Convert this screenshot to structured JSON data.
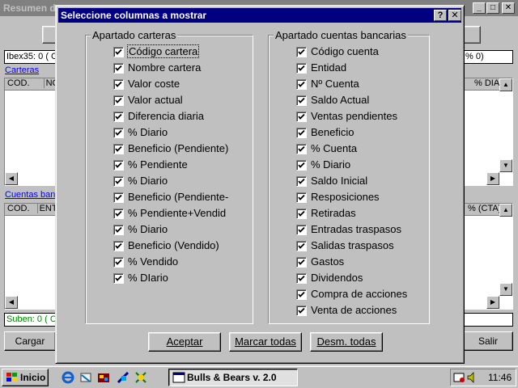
{
  "main_window": {
    "title": "Resumen d",
    "ibex_text": "Ibex35: 0  ( C",
    "ibex_right_text": "%  0)",
    "carteras_link": "Carteras",
    "grid1_headers": [
      "COD.",
      "NO"
    ],
    "grid1_right_header": "% DIA",
    "cuentas_link": "Cuentas banc",
    "grid2_headers": [
      "COD.",
      "ENT"
    ],
    "grid2_right_header": "% (CTA)",
    "suben_text": "Suben: 0  ( C",
    "cargar_label": "Cargar",
    "salir_label": "Salir"
  },
  "dialog": {
    "title": "Seleccione columnas a mostrar",
    "help_button": "?",
    "close_button": "✕",
    "group_carteras": {
      "legend": "Apartado carteras",
      "options": [
        {
          "label": "Código cartera",
          "checked": true
        },
        {
          "label": "Nombre cartera",
          "checked": true
        },
        {
          "label": "Valor coste",
          "checked": true
        },
        {
          "label": "Valor actual",
          "checked": true
        },
        {
          "label": "Diferencia diaria",
          "checked": true
        },
        {
          "label": "% Diario",
          "checked": true
        },
        {
          "label": "Beneficio (Pendiente)",
          "checked": true
        },
        {
          "label": "% Pendiente",
          "checked": true
        },
        {
          "label": "% Diario",
          "checked": true
        },
        {
          "label": "Beneficio (Pendiente-",
          "checked": true
        },
        {
          "label": "% Pendiente+Vendid",
          "checked": true
        },
        {
          "label": "% Diario",
          "checked": true
        },
        {
          "label": "Beneficio (Vendido)",
          "checked": true
        },
        {
          "label": "% Vendido",
          "checked": true
        },
        {
          "label": "% DIario",
          "checked": true
        }
      ]
    },
    "group_cuentas": {
      "legend": "Apartado cuentas bancarias",
      "options": [
        {
          "label": "Código cuenta",
          "checked": true
        },
        {
          "label": "Entidad",
          "checked": true
        },
        {
          "label": "Nº Cuenta",
          "checked": true
        },
        {
          "label": "Saldo Actual",
          "checked": true
        },
        {
          "label": "Ventas pendientes",
          "checked": true
        },
        {
          "label": "Beneficio",
          "checked": true
        },
        {
          "label": "% Cuenta",
          "checked": true
        },
        {
          "label": "% Diario",
          "checked": true
        },
        {
          "label": "Saldo Inicial",
          "checked": true
        },
        {
          "label": "Resposiciones",
          "checked": true
        },
        {
          "label": "Retiradas",
          "checked": true
        },
        {
          "label": "Entradas traspasos",
          "checked": true
        },
        {
          "label": "Salidas traspasos",
          "checked": true
        },
        {
          "label": "Gastos",
          "checked": true
        },
        {
          "label": "Dividendos",
          "checked": true
        },
        {
          "label": "Compra de acciones",
          "checked": true
        },
        {
          "label": "Venta de acciones",
          "checked": true
        }
      ]
    },
    "buttons": {
      "accept": "Aceptar",
      "mark_all": "Marcar todas",
      "unmark_all": "Desm. todas"
    }
  },
  "taskbar": {
    "start_label": "Inicio",
    "task_label": "Bulls & Bears v. 2.0",
    "clock": "11:46"
  }
}
